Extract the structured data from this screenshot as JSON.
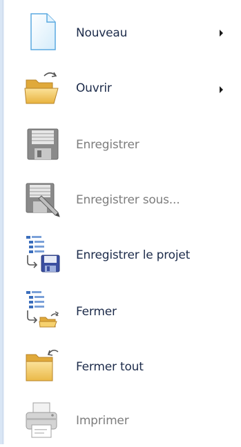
{
  "menu": {
    "items": [
      {
        "label": "Nouveau",
        "icon": "new-document-icon",
        "enabled": true,
        "has_submenu": true
      },
      {
        "label": "Ouvrir",
        "icon": "open-folder-icon",
        "enabled": true,
        "has_submenu": true
      },
      {
        "label": "Enregistrer",
        "icon": "save-icon",
        "enabled": false,
        "has_submenu": false
      },
      {
        "label": "Enregistrer sous...",
        "icon": "save-as-icon",
        "enabled": false,
        "has_submenu": false
      },
      {
        "label": "Enregistrer le projet",
        "icon": "save-project-icon",
        "enabled": true,
        "has_submenu": false
      },
      {
        "label": "Fermer",
        "icon": "close-project-icon",
        "enabled": true,
        "has_submenu": false
      },
      {
        "label": "Fermer tout",
        "icon": "close-all-folder-icon",
        "enabled": true,
        "has_submenu": false
      },
      {
        "label": "Imprimer",
        "icon": "printer-icon",
        "enabled": false,
        "has_submenu": false
      }
    ]
  },
  "colors": {
    "enabled_text": "#1c2b4a",
    "disabled_text": "#7d7d7d",
    "folder": "#f3c85a",
    "floppy_blue": "#3b4fa0"
  }
}
